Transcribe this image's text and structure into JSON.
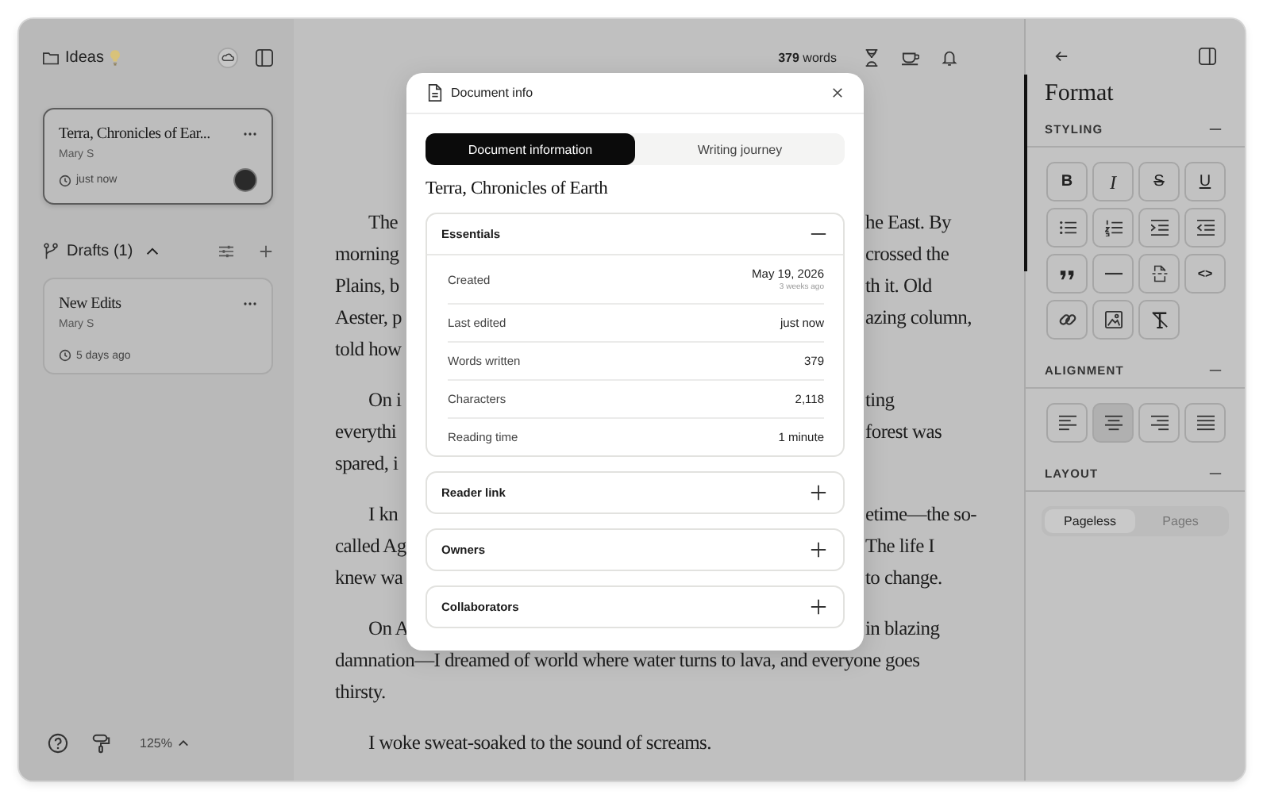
{
  "sidebar": {
    "folder": "Ideas",
    "documents": [
      {
        "title": "Terra, Chronicles of Ear...",
        "author": "Mary S",
        "time": "just now",
        "selected": true,
        "avatar": true
      }
    ],
    "drafts_label": "Drafts (1)",
    "drafts_expanded": true,
    "drafts": [
      {
        "title": "New Edits",
        "author": "Mary S",
        "time": "5 days ago",
        "selected": false,
        "avatar": false
      }
    ],
    "zoom": "125%"
  },
  "editor": {
    "word_count": "**379** words",
    "paragraphs": [
      {
        "lines": [
          {
            "left": "The",
            "right": "he East. By"
          },
          {
            "left": "morning",
            "right": "crossed the"
          },
          {
            "left": "Plains, b",
            "right": "th it. Old"
          },
          {
            "left": "Aester, p",
            "right": "azing column,"
          },
          {
            "left": "told how"
          }
        ]
      },
      {
        "lines": [
          {
            "left": "On i",
            "right": "ting"
          },
          {
            "left": "everythi",
            "right": "forest was"
          },
          {
            "left": "spared, i"
          }
        ]
      },
      {
        "lines": [
          {
            "left": "I kn",
            "right": "etime—the so-"
          },
          {
            "left": "called Ag",
            "right": "The life I"
          },
          {
            "left": "knew wa",
            "right": "to change."
          }
        ]
      },
      {
        "lines": [
          {
            "left": "On A",
            "right": "in blazing"
          },
          {
            "full": "damnation—I dreamed of world where water turns to lava, and everyone goes"
          },
          {
            "full": "thirsty."
          }
        ]
      },
      {
        "lines": [
          {
            "full": "I woke sweat-soaked to the sound of screams."
          }
        ]
      }
    ]
  },
  "modal": {
    "title": "Document info",
    "tabs": [
      {
        "label": "Document information",
        "selected": true
      },
      {
        "label": "Writing journey",
        "selected": false
      }
    ],
    "doc_title": "Terra, Chronicles of Earth",
    "sections": [
      {
        "title": "Essentials",
        "expanded": true,
        "rows": [
          {
            "label": "Created",
            "value": "May 19, 2026",
            "note": "3 weeks ago"
          },
          {
            "label": "Last edited",
            "value": "just now"
          },
          {
            "label": "Words written",
            "value": "379"
          },
          {
            "label": "Characters",
            "value": "2,118"
          },
          {
            "label": "Reading time",
            "value": "1 minute"
          }
        ]
      },
      {
        "title": "Reader link",
        "expanded": false
      },
      {
        "title": "Owners",
        "expanded": false
      },
      {
        "title": "Collaborators",
        "expanded": false
      }
    ]
  },
  "format_panel": {
    "title": "Format",
    "styling": {
      "title": "STYLING",
      "expanded": true,
      "tools": [
        {
          "kind": "bold",
          "label": "B"
        },
        {
          "kind": "italic",
          "label": "I"
        },
        {
          "kind": "strike",
          "label": "S"
        },
        {
          "kind": "underline",
          "label": "U"
        },
        {
          "kind": "bullet-list"
        },
        {
          "kind": "numbered-list"
        },
        {
          "kind": "indent"
        },
        {
          "kind": "outdent"
        },
        {
          "kind": "quote"
        },
        {
          "kind": "divider"
        },
        {
          "kind": "page-break"
        },
        {
          "kind": "code",
          "label": "<>"
        },
        {
          "kind": "link"
        },
        {
          "kind": "image"
        },
        {
          "kind": "clear-format"
        }
      ]
    },
    "alignment": {
      "title": "ALIGNMENT",
      "expanded": true,
      "options": [
        {
          "kind": "left",
          "selected": false
        },
        {
          "kind": "center",
          "selected": true
        },
        {
          "kind": "right",
          "selected": false
        },
        {
          "kind": "justify",
          "selected": false
        }
      ]
    },
    "layout": {
      "title": "LAYOUT",
      "expanded": true,
      "options": [
        {
          "label": "Pageless",
          "selected": true
        },
        {
          "label": "Pages",
          "selected": false
        }
      ]
    }
  }
}
